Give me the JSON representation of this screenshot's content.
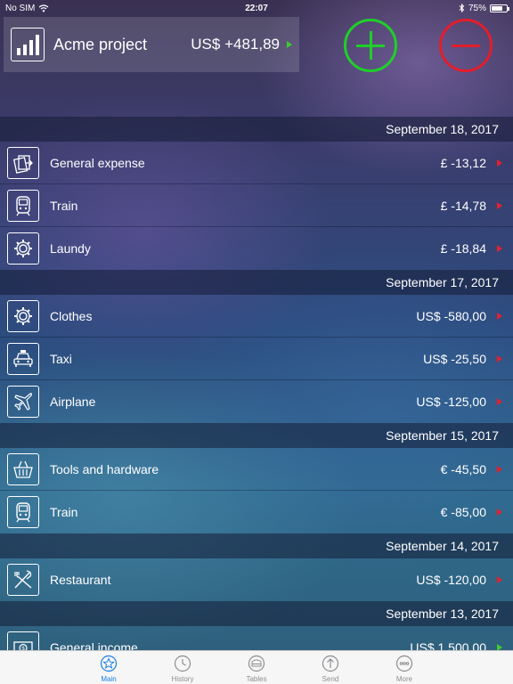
{
  "status_bar": {
    "carrier": "No SIM",
    "time": "22:07",
    "battery": "75%",
    "battery_level": 0.75
  },
  "project": {
    "title": "Acme project",
    "amount": "US$ +481,89"
  },
  "colors": {
    "income_arrow": "#3ecc2b",
    "expense_arrow": "#e3202f",
    "plus_button": "#1fcf2a",
    "minus_button": "#e21e2c",
    "active_tab": "#1a7fe0"
  },
  "groups": [
    {
      "date": "September 18, 2017",
      "items": [
        {
          "label": "General expense",
          "amount": "£ -13,12",
          "icon": "cards-icon",
          "type": "expense"
        },
        {
          "label": "Train",
          "amount": "£ -14,78",
          "icon": "train-icon",
          "type": "expense"
        },
        {
          "label": "Laundy",
          "amount": "£ -18,84",
          "icon": "gear-icon",
          "type": "expense"
        }
      ]
    },
    {
      "date": "September 17, 2017",
      "items": [
        {
          "label": "Clothes",
          "amount": "US$ -580,00",
          "icon": "gear-icon",
          "type": "expense"
        },
        {
          "label": "Taxi",
          "amount": "US$ -25,50",
          "icon": "taxi-icon",
          "type": "expense"
        },
        {
          "label": "Airplane",
          "amount": "US$ -125,00",
          "icon": "airplane-icon",
          "type": "expense"
        }
      ]
    },
    {
      "date": "September 15, 2017",
      "items": [
        {
          "label": "Tools and hardware",
          "amount": "€ -45,50",
          "icon": "basket-icon",
          "type": "expense"
        },
        {
          "label": "Train",
          "amount": "€ -85,00",
          "icon": "train-icon",
          "type": "expense"
        }
      ]
    },
    {
      "date": "September 14, 2017",
      "items": [
        {
          "label": "Restaurant",
          "amount": "US$ -120,00",
          "icon": "fork-knife-icon",
          "type": "expense"
        }
      ]
    },
    {
      "date": "September 13, 2017",
      "items": [
        {
          "label": "General income",
          "amount": "US$ 1.500,00",
          "icon": "banknote-icon",
          "type": "income"
        }
      ]
    }
  ],
  "tabs": [
    {
      "label": "Main",
      "icon": "star-icon",
      "active": true
    },
    {
      "label": "History",
      "icon": "clock-icon",
      "active": false
    },
    {
      "label": "Tables",
      "icon": "tables-icon",
      "active": false
    },
    {
      "label": "Send",
      "icon": "send-icon",
      "active": false
    },
    {
      "label": "More",
      "icon": "more-icon",
      "active": false
    }
  ]
}
